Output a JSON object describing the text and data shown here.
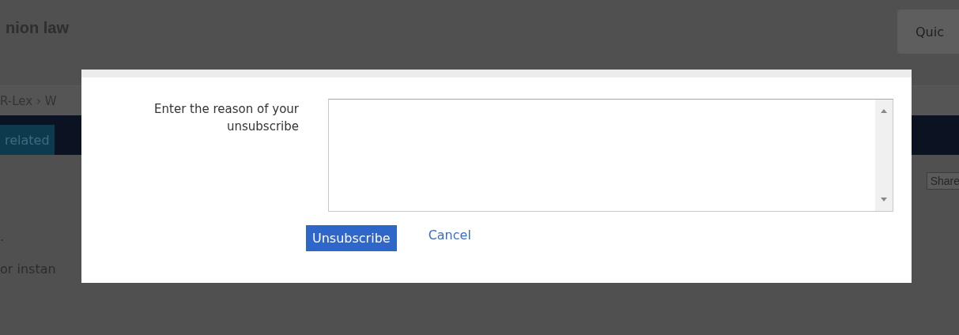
{
  "page": {
    "title": "nion law",
    "search_text": "Quic",
    "breadcrumb": "R-Lex › W",
    "banner": "related",
    "share": "Share",
    "text_1": ".",
    "text_2": "or instan"
  },
  "dialog": {
    "label": "Enter the reason of your unsubscribe",
    "buttons": [
      {
        "label": "Unsubscribe",
        "kind": "primary"
      },
      {
        "label": "Cancel",
        "kind": "link"
      }
    ]
  }
}
